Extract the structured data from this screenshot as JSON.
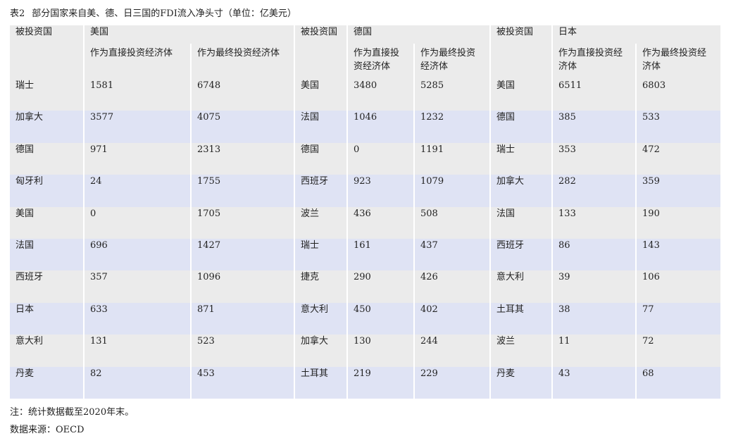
{
  "title": {
    "number": "表2",
    "text": "部分国家来自美、德、日三国的FDI流入净头寸（单位：亿美元）"
  },
  "table": {
    "groups": [
      {
        "name": "美国",
        "host_label": "被投资国",
        "col1_label": "作为直接投资经济体",
        "col2_label": "作为最终投资经济体"
      },
      {
        "name": "德国",
        "host_label": "被投资国",
        "col1_label": "作为直接投资经济体",
        "col2_label": "作为最终投资经济体"
      },
      {
        "name": "日本",
        "host_label": "被投资国",
        "col1_label": "作为直接投资经济体",
        "col2_label": "作为最终投资经济体"
      }
    ],
    "rows": [
      {
        "us_host": "瑞士",
        "us_direct": "1581",
        "us_final": "6748",
        "de_host": "美国",
        "de_direct": "3480",
        "de_final": "5285",
        "jp_host": "美国",
        "jp_direct": "6511",
        "jp_final": "6803"
      },
      {
        "us_host": "加拿大",
        "us_direct": "3577",
        "us_final": "4075",
        "de_host": "法国",
        "de_direct": "1046",
        "de_final": "1232",
        "jp_host": "德国",
        "jp_direct": "385",
        "jp_final": "533"
      },
      {
        "us_host": "德国",
        "us_direct": "971",
        "us_final": "2313",
        "de_host": "德国",
        "de_direct": "0",
        "de_final": "1191",
        "jp_host": "瑞士",
        "jp_direct": "353",
        "jp_final": "472"
      },
      {
        "us_host": "匈牙利",
        "us_direct": "24",
        "us_final": "1755",
        "de_host": "西班牙",
        "de_direct": "923",
        "de_final": "1079",
        "jp_host": "加拿大",
        "jp_direct": "282",
        "jp_final": "359"
      },
      {
        "us_host": "美国",
        "us_direct": "0",
        "us_final": "1705",
        "de_host": "波兰",
        "de_direct": "436",
        "de_final": "508",
        "jp_host": "法国",
        "jp_direct": "133",
        "jp_final": "190"
      },
      {
        "us_host": "法国",
        "us_direct": "696",
        "us_final": "1427",
        "de_host": "瑞士",
        "de_direct": "161",
        "de_final": "437",
        "jp_host": "西班牙",
        "jp_direct": "86",
        "jp_final": "143"
      },
      {
        "us_host": "西班牙",
        "us_direct": "357",
        "us_final": "1096",
        "de_host": "捷克",
        "de_direct": "290",
        "de_final": "426",
        "jp_host": "意大利",
        "jp_direct": "39",
        "jp_final": "106"
      },
      {
        "us_host": "日本",
        "us_direct": "633",
        "us_final": "871",
        "de_host": "意大利",
        "de_direct": "450",
        "de_final": "402",
        "jp_host": "土耳其",
        "jp_direct": "38",
        "jp_final": "77"
      },
      {
        "us_host": "意大利",
        "us_direct": "131",
        "us_final": "523",
        "de_host": "加拿大",
        "de_direct": "130",
        "de_final": "244",
        "jp_host": "波兰",
        "jp_direct": "11",
        "jp_final": "72"
      },
      {
        "us_host": "丹麦",
        "us_direct": "82",
        "us_final": "453",
        "de_host": "土耳其",
        "de_direct": "219",
        "de_final": "229",
        "jp_host": "丹麦",
        "jp_direct": "43",
        "jp_final": "68"
      }
    ]
  },
  "footer": {
    "note": "注：统计数据截至2020年末。",
    "source": "数据来源：OECD"
  },
  "colors": {
    "header_bg": "#ebebeb",
    "row_blue": "#dfe3f4",
    "row_gray": "#ebebeb"
  }
}
